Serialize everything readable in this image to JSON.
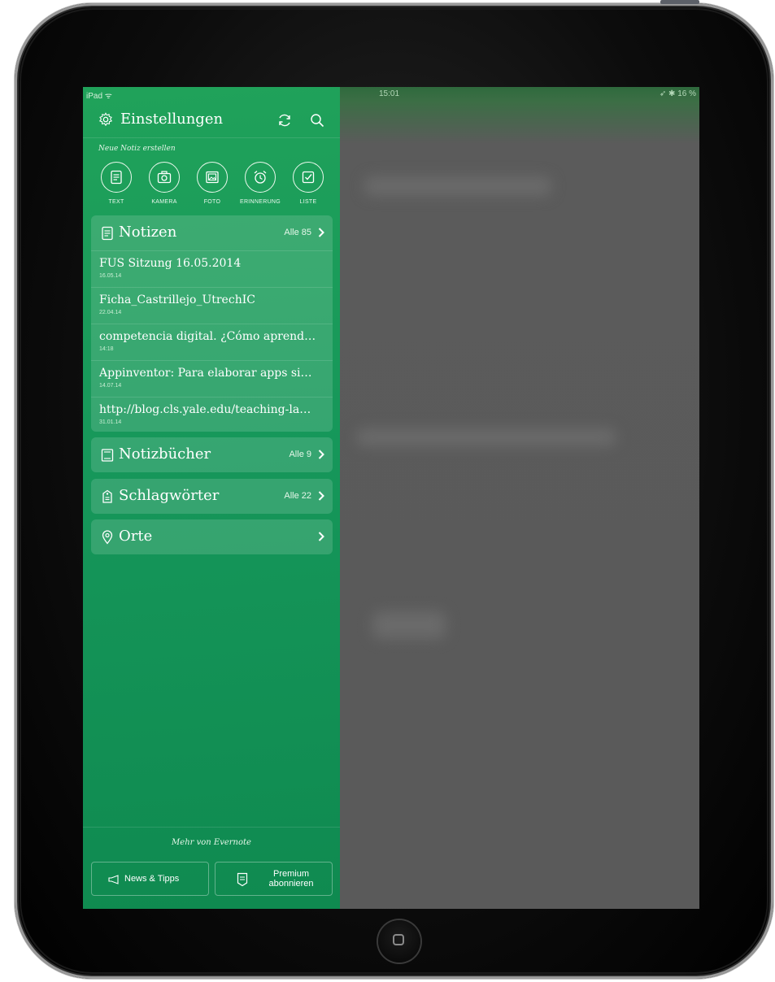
{
  "status_bar": {
    "device": "iPad ᯤ",
    "time": "15:01",
    "battery": "➶ ✱ 16 %"
  },
  "header": {
    "title": "Einstellungen",
    "icons": [
      "gear-icon",
      "sync-icon",
      "search-icon"
    ]
  },
  "new_note": {
    "label": "Neue Notiz erstellen",
    "actions": [
      {
        "label": "TEXT",
        "icon": "text-note-icon"
      },
      {
        "label": "KAMERA",
        "icon": "camera-icon"
      },
      {
        "label": "FOTO",
        "icon": "photo-icon"
      },
      {
        "label": "ERINNERUNG",
        "icon": "alarm-icon"
      },
      {
        "label": "LISTE",
        "icon": "checklist-icon"
      }
    ]
  },
  "notes_section": {
    "title": "Notizen",
    "count": "Alle 85",
    "items": [
      {
        "title": "FUS Sitzung 16.05.2014",
        "date": "16.05.14"
      },
      {
        "title": "Ficha_Castrillejo_UtrechIC",
        "date": "22.04.14"
      },
      {
        "title": "competencia digital. ¿Cómo aprend…",
        "date": "14:18"
      },
      {
        "title": "Appinventor: Para elaborar apps si…",
        "date": "14.07.14"
      },
      {
        "title": "http://blog.cls.yale.edu/teaching-la…",
        "date": "31.01.14"
      }
    ]
  },
  "notebooks_section": {
    "title": "Notizbücher",
    "count": "Alle 9"
  },
  "tags_section": {
    "title": "Schlagwörter",
    "count": "Alle 22"
  },
  "places_section": {
    "title": "Orte"
  },
  "footer": {
    "label": "Mehr von Evernote",
    "news_button": "News & Tipps",
    "premium_line1": "Premium",
    "premium_line2": "abonnieren"
  },
  "colors": {
    "sidebar_green": "#16975a",
    "overlay_gray": "#5b5b5b",
    "text_white": "#ffffff"
  }
}
